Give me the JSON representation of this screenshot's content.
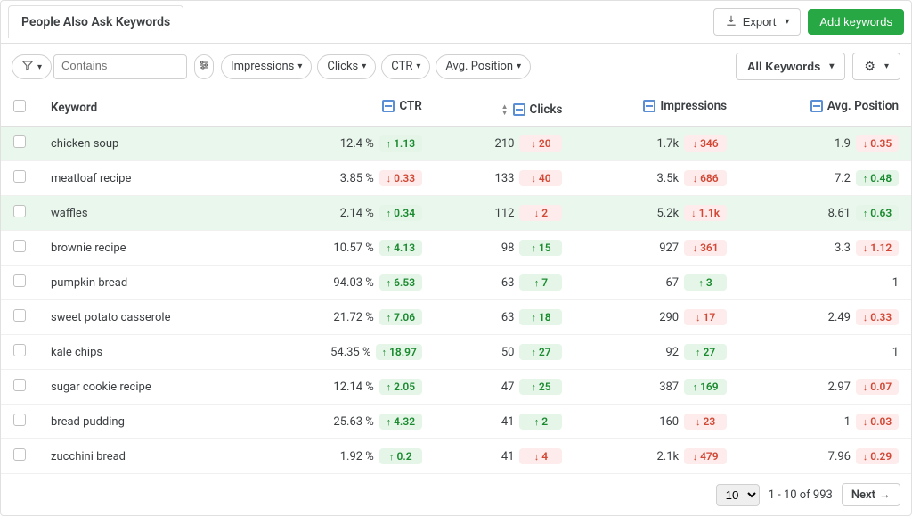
{
  "header": {
    "tab": "People Also Ask Keywords",
    "export": "Export",
    "add": "Add keywords"
  },
  "toolbar": {
    "contains_placeholder": "Contains",
    "chips": [
      "Impressions",
      "Clicks",
      "CTR",
      "Avg. Position"
    ],
    "all_keywords": "All Keywords"
  },
  "columns": {
    "keyword": "Keyword",
    "ctr": "CTR",
    "clicks": "Clicks",
    "impressions": "Impressions",
    "avgpos": "Avg. Position"
  },
  "rows": [
    {
      "hl": true,
      "keyword": "chicken soup",
      "ctr": "12.4 %",
      "ctr_d": "1.13",
      "ctr_dir": "up",
      "clicks": "210",
      "clicks_d": "20",
      "clicks_dir": "down",
      "imp": "1.7k",
      "imp_d": "346",
      "imp_dir": "down",
      "avg": "1.9",
      "avg_d": "0.35",
      "avg_dir": "down"
    },
    {
      "hl": false,
      "keyword": "meatloaf recipe",
      "ctr": "3.85 %",
      "ctr_d": "0.33",
      "ctr_dir": "down",
      "clicks": "133",
      "clicks_d": "40",
      "clicks_dir": "down",
      "imp": "3.5k",
      "imp_d": "686",
      "imp_dir": "down",
      "avg": "7.2",
      "avg_d": "0.48",
      "avg_dir": "up"
    },
    {
      "hl": true,
      "keyword": "waffles",
      "ctr": "2.14 %",
      "ctr_d": "0.34",
      "ctr_dir": "up",
      "clicks": "112",
      "clicks_d": "2",
      "clicks_dir": "down",
      "imp": "5.2k",
      "imp_d": "1.1k",
      "imp_dir": "down",
      "avg": "8.61",
      "avg_d": "0.63",
      "avg_dir": "up"
    },
    {
      "hl": false,
      "keyword": "brownie recipe",
      "ctr": "10.57 %",
      "ctr_d": "4.13",
      "ctr_dir": "up",
      "clicks": "98",
      "clicks_d": "15",
      "clicks_dir": "up",
      "imp": "927",
      "imp_d": "361",
      "imp_dir": "down",
      "avg": "3.3",
      "avg_d": "1.12",
      "avg_dir": "down"
    },
    {
      "hl": false,
      "keyword": "pumpkin bread",
      "ctr": "94.03 %",
      "ctr_d": "6.53",
      "ctr_dir": "up",
      "clicks": "63",
      "clicks_d": "7",
      "clicks_dir": "up",
      "imp": "67",
      "imp_d": "3",
      "imp_dir": "up",
      "avg": "1",
      "avg_d": "",
      "avg_dir": ""
    },
    {
      "hl": false,
      "keyword": "sweet potato casserole",
      "ctr": "21.72 %",
      "ctr_d": "7.06",
      "ctr_dir": "up",
      "clicks": "63",
      "clicks_d": "18",
      "clicks_dir": "up",
      "imp": "290",
      "imp_d": "17",
      "imp_dir": "down",
      "avg": "2.49",
      "avg_d": "0.33",
      "avg_dir": "down"
    },
    {
      "hl": false,
      "keyword": "kale chips",
      "ctr": "54.35 %",
      "ctr_d": "18.97",
      "ctr_dir": "up",
      "clicks": "50",
      "clicks_d": "27",
      "clicks_dir": "up",
      "imp": "92",
      "imp_d": "27",
      "imp_dir": "up",
      "avg": "1",
      "avg_d": "",
      "avg_dir": ""
    },
    {
      "hl": false,
      "keyword": "sugar cookie recipe",
      "ctr": "12.14 %",
      "ctr_d": "2.05",
      "ctr_dir": "up",
      "clicks": "47",
      "clicks_d": "25",
      "clicks_dir": "up",
      "imp": "387",
      "imp_d": "169",
      "imp_dir": "up",
      "avg": "2.97",
      "avg_d": "0.07",
      "avg_dir": "down"
    },
    {
      "hl": false,
      "keyword": "bread pudding",
      "ctr": "25.63 %",
      "ctr_d": "4.32",
      "ctr_dir": "up",
      "clicks": "41",
      "clicks_d": "2",
      "clicks_dir": "up",
      "imp": "160",
      "imp_d": "23",
      "imp_dir": "down",
      "avg": "1",
      "avg_d": "0.03",
      "avg_dir": "down"
    },
    {
      "hl": false,
      "keyword": "zucchini bread",
      "ctr": "1.92 %",
      "ctr_d": "0.2",
      "ctr_dir": "up",
      "clicks": "41",
      "clicks_d": "4",
      "clicks_dir": "down",
      "imp": "2.1k",
      "imp_d": "479",
      "imp_dir": "down",
      "avg": "7.96",
      "avg_d": "0.29",
      "avg_dir": "down"
    }
  ],
  "footer": {
    "pagesize": "10",
    "range": "1 - 10 of 993",
    "next": "Next"
  }
}
